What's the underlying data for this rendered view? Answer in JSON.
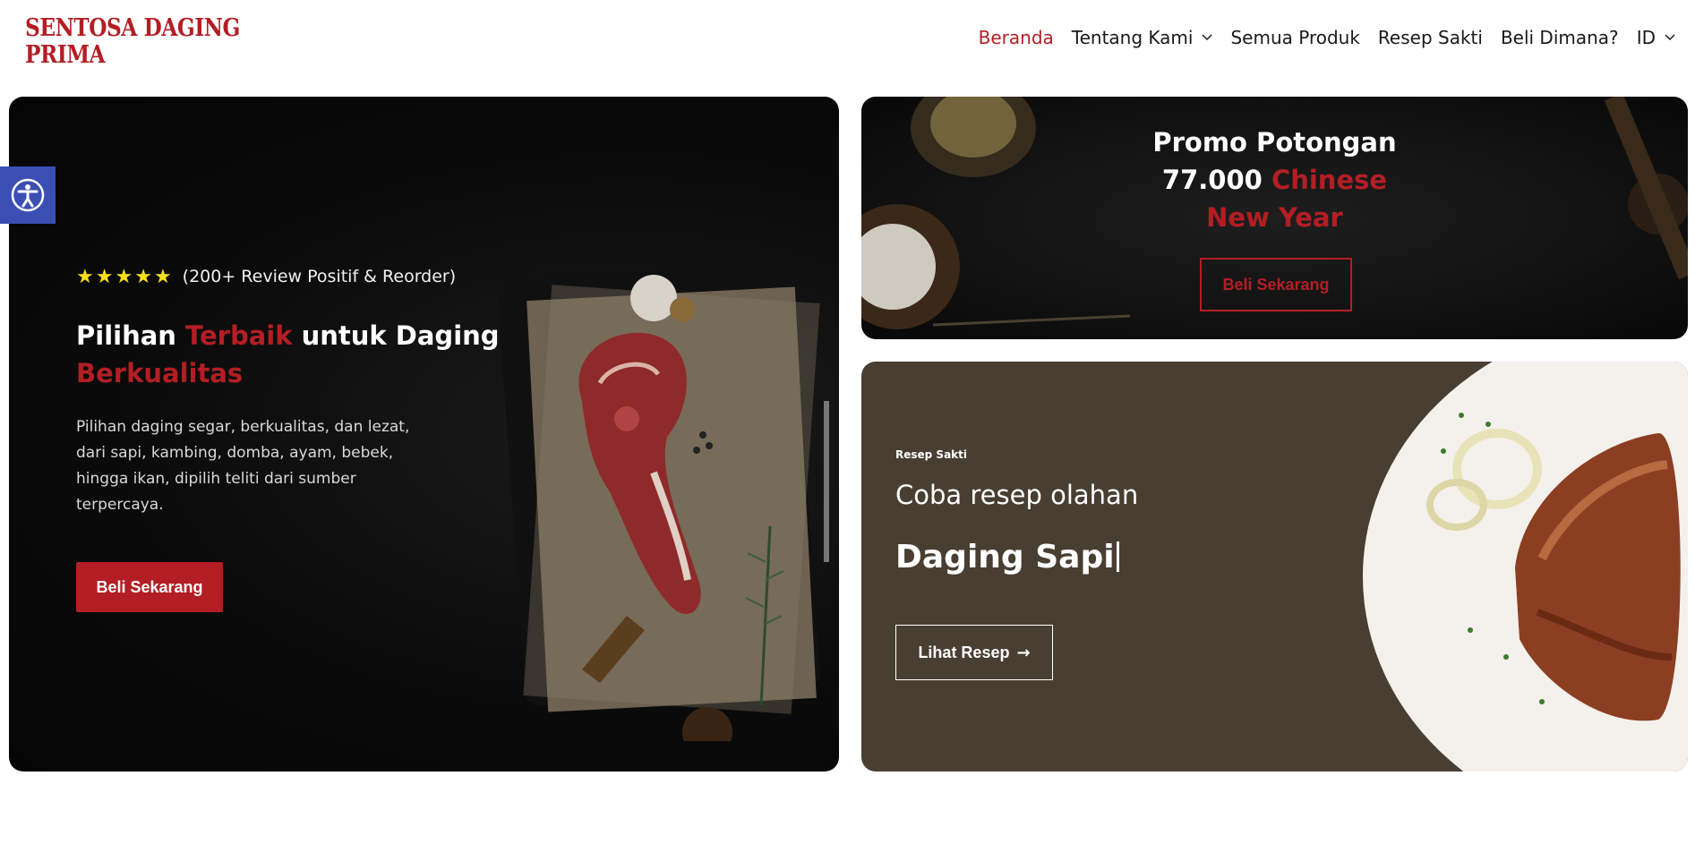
{
  "brand": {
    "name_line1": "SENTOSA DAGING",
    "name_line2": "PRIMA",
    "color": "#b31e24"
  },
  "nav": {
    "items": [
      {
        "label": "Beranda",
        "active": true
      },
      {
        "label": "Tentang Kami",
        "dropdown": true
      },
      {
        "label": "Semua Produk"
      },
      {
        "label": "Resep Sakti"
      },
      {
        "label": "Beli Dimana?"
      },
      {
        "label": "ID",
        "dropdown": true
      }
    ]
  },
  "accessibility": {
    "icon": "accessibility-icon",
    "color": "#3b4fb3"
  },
  "hero": {
    "stars": 5,
    "rating_text": "(200+ Review Positif & Reorder)",
    "title_part1": "Pilihan ",
    "title_highlight": "Terbaik",
    "title_part2": " untuk Daging",
    "title_highlight2": "Berkualitas",
    "description": "Pilihan daging segar, berkualitas, dan lezat, dari sapi, kambing, domba, ayam, bebek, hingga ikan, dipilih teliti dari sumber terpercaya.",
    "cta": "Beli Sekarang"
  },
  "promo": {
    "line1": "Promo Potongan",
    "line2_number": "77.000",
    "line2_highlight": " Chinese",
    "line3_highlight": "New Year",
    "cta": "Beli Sekarang"
  },
  "recipe": {
    "kicker": "Resep Sakti",
    "line1": "Coba resep olahan",
    "line2": "Daging Sapi",
    "cta": "Lihat Resep",
    "cta_arrow": "→",
    "bg_color": "#493e32"
  }
}
